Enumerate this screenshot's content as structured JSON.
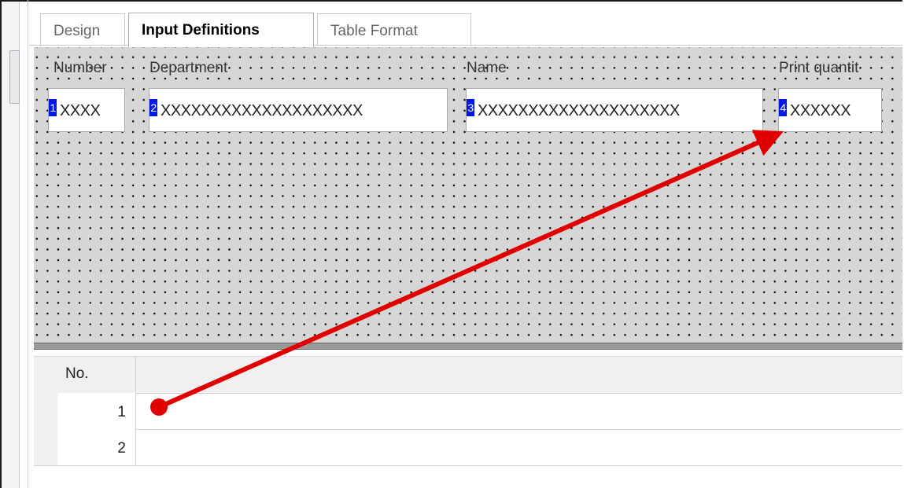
{
  "tabs": [
    {
      "label": "Design",
      "active": false
    },
    {
      "label": "Input Definitions",
      "active": true
    },
    {
      "label": "Table Format",
      "active": false
    }
  ],
  "design": {
    "fields": [
      {
        "label": "Number",
        "badge": "1",
        "value": "XXXX"
      },
      {
        "label": "Department",
        "badge": "2",
        "value": "XXXXXXXXXXXXXXXXXXXX"
      },
      {
        "label": "Name",
        "badge": "3",
        "value": "XXXXXXXXXXXXXXXXXXXX"
      },
      {
        "label": "Print quantit",
        "badge": "4",
        "value": "XXXXXX"
      }
    ]
  },
  "grid": {
    "header_no": "No.",
    "rows": [
      {
        "no": "1"
      },
      {
        "no": "2"
      }
    ]
  },
  "annotation": {
    "color": "#e00000"
  }
}
